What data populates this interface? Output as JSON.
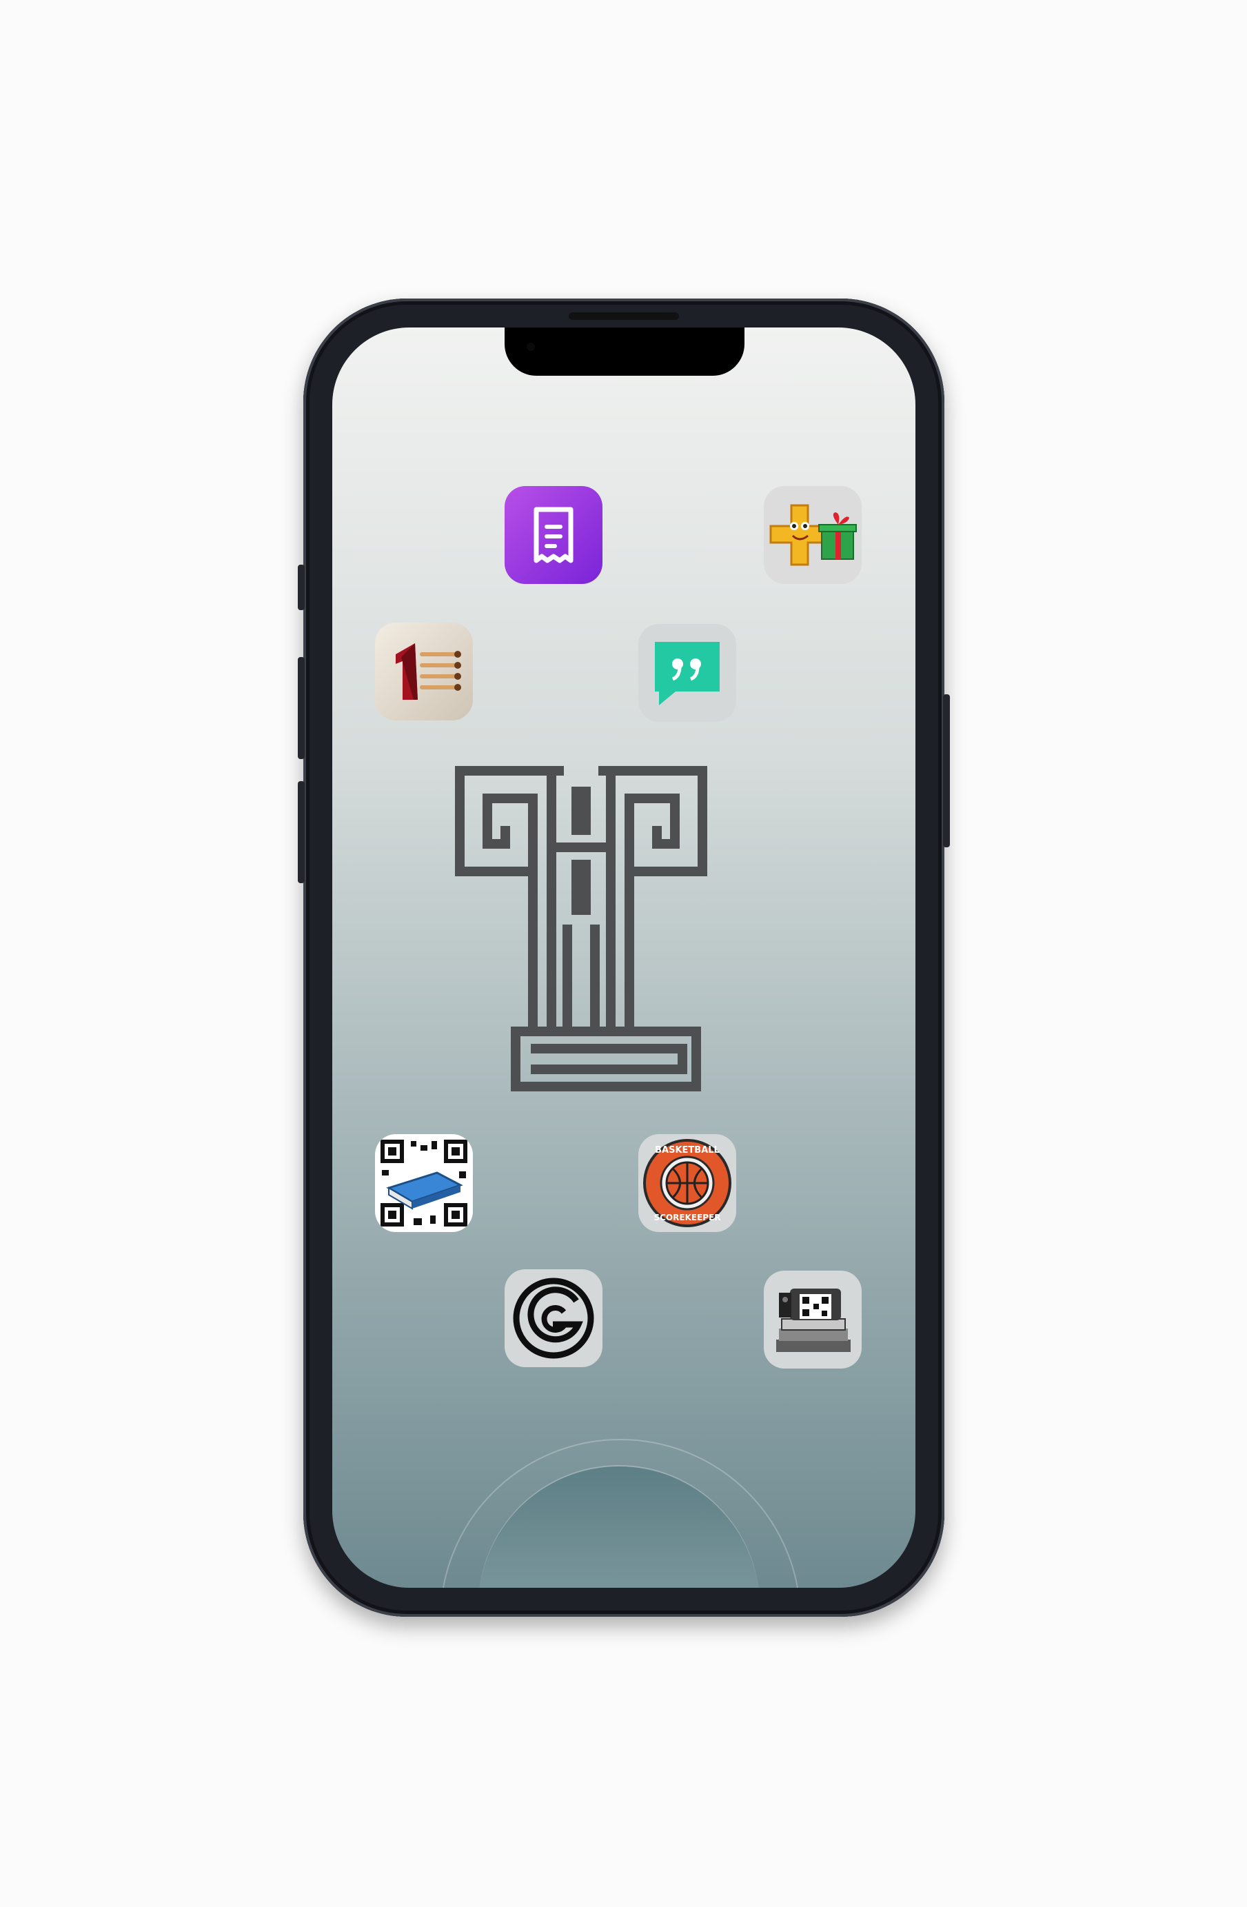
{
  "home_screen": {
    "apps": [
      {
        "id": "receipt-app",
        "icon": "receipt-icon",
        "color": "#9b3fe0"
      },
      {
        "id": "plus-gift-app",
        "icon": "plus-gift-icon",
        "color": "#f2b722"
      },
      {
        "id": "matches-app",
        "icon": "number-one-matches-icon",
        "color": "#a3121e"
      },
      {
        "id": "quote-chat-app",
        "icon": "quote-bubble-icon",
        "color": "#22c9a3"
      },
      {
        "id": "qr-book-app",
        "icon": "qr-book-icon",
        "color": "#3a86d6"
      },
      {
        "id": "basketball-app",
        "icon": "basketball-scorekeeper-icon",
        "color": "#e2572a"
      },
      {
        "id": "g-logo-app",
        "icon": "letter-g-icon",
        "color": "#111111"
      },
      {
        "id": "qr-printer-app",
        "icon": "qr-printer-icon",
        "color": "#555555"
      }
    ],
    "wallpaper_logo": "greek-column-t-logo",
    "basketball_badge": {
      "top_text": "BASKETBALL",
      "bottom_text": "SCOREKEEPER"
    }
  }
}
